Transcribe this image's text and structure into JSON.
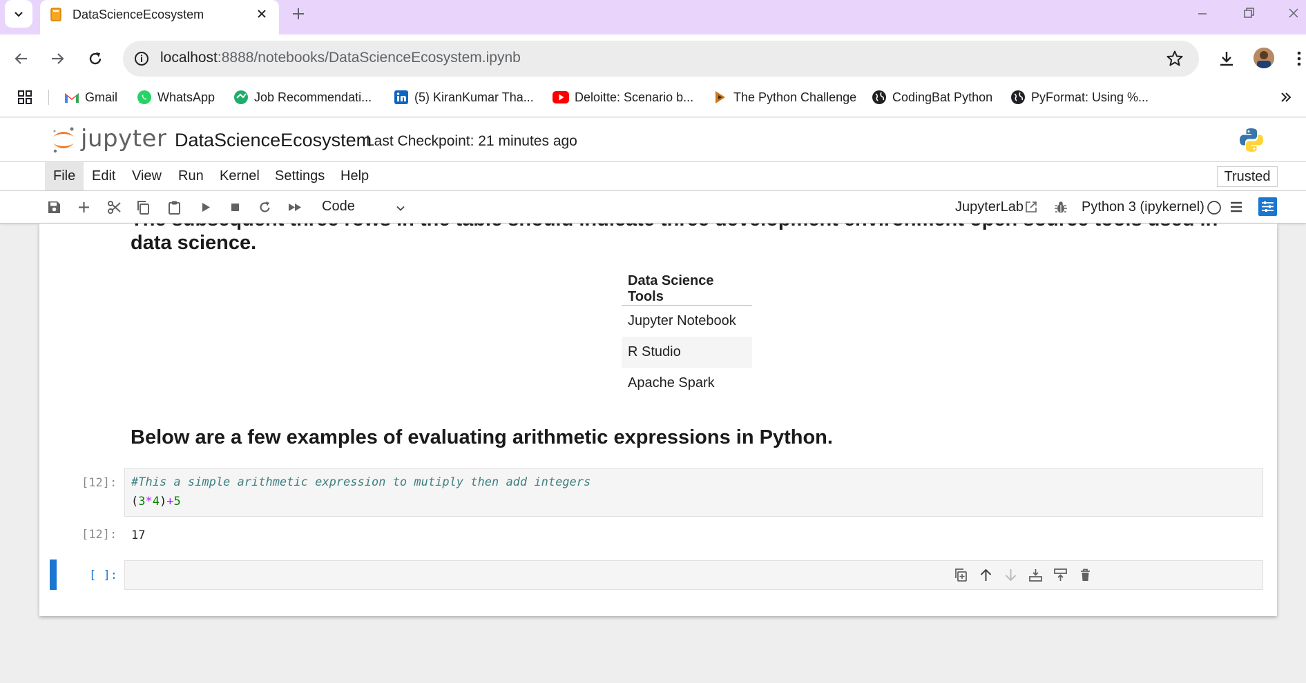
{
  "browser": {
    "tab_title": "DataScienceEcosystem",
    "url_host": "localhost",
    "url_path": ":8888/notebooks/DataScienceEcosystem.ipynb",
    "bookmarks": [
      {
        "label": "Gmail",
        "icon": "gmail-icon"
      },
      {
        "label": "WhatsApp",
        "icon": "whatsapp-icon"
      },
      {
        "label": "Job Recommendati...",
        "icon": "job-icon"
      },
      {
        "label": "(5) KiranKumar Tha...",
        "icon": "linkedin-icon"
      },
      {
        "label": "Deloitte: Scenario b...",
        "icon": "youtube-icon"
      },
      {
        "label": "The Python Challenge",
        "icon": "python-challenge-icon"
      },
      {
        "label": "CodingBat Python",
        "icon": "globe-icon"
      },
      {
        "label": "PyFormat: Using %...",
        "icon": "globe-icon"
      }
    ]
  },
  "jupyter": {
    "wordmark": "jupyter",
    "notebook_name": "DataScienceEcosystem",
    "checkpoint": "Last Checkpoint: 21 minutes ago",
    "menu": [
      "File",
      "Edit",
      "View",
      "Run",
      "Kernel",
      "Settings",
      "Help"
    ],
    "trusted": "Trusted",
    "cell_type": "Code",
    "jupyterlab_link": "JupyterLab",
    "kernel": "Python 3 (ipykernel)"
  },
  "notebook": {
    "md_clipped_line": "The subsequent three rows in the table should indicate three development environment open source tools used in",
    "md_line2": "data science.",
    "table": {
      "header": "Data Science Tools",
      "rows": [
        "Jupyter Notebook",
        "R Studio",
        "Apache Spark"
      ]
    },
    "md_heading": "Below are a few examples of evaluating arithmetic expressions in Python.",
    "code_cell": {
      "prompt": "[12]:",
      "comment": "#This a simple arithmetic expression to mutiply then add integers",
      "expr": {
        "p1": "(",
        "n1": "3",
        "op1": "*",
        "n2": "4",
        "p2": ")",
        "op2": "+",
        "n3": "5"
      }
    },
    "output": {
      "prompt": "[12]:",
      "value": "17"
    },
    "empty_cell_prompt": "[ ]:"
  }
}
